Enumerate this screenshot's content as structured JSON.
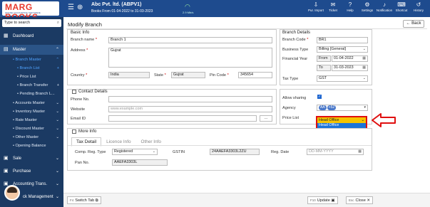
{
  "header": {
    "logo_text": "MARG BOOKS",
    "logo_tagline": "ONLINE ACCOUNTING SOFTWARE",
    "company": "Abc Pvt. ltd. (ABPV1)",
    "books_from": "Books From 01-04-2022 to 31-03-2023",
    "speed": "2.9 Mb/s",
    "tools": [
      {
        "label": "Pur. Import",
        "icon": "download-icon"
      },
      {
        "label": "Ticket",
        "icon": "ticket-icon"
      },
      {
        "label": "Help",
        "icon": "help-icon"
      },
      {
        "label": "Settings",
        "icon": "gear-icon"
      },
      {
        "label": "Notification",
        "icon": "bell-icon"
      },
      {
        "label": "Shortcut",
        "icon": "keyboard-icon"
      },
      {
        "label": "History",
        "icon": "history-icon"
      }
    ]
  },
  "sidebar": {
    "search_placeholder": "Type to search",
    "dashboard": "Dashboard",
    "master": "Master",
    "branch_master": "Branch Master",
    "branch_list": "Branch List",
    "price_list": "Price List",
    "branch_transfer": "Branch Transfer",
    "pending_branch": "Pending Branch L...",
    "accounts_master": "Accounts Master",
    "inventory_master": "Inventory Master",
    "rate_master": "Rate Master",
    "discount_master": "Discount Master",
    "other_master": "Other Master",
    "opening_balance": "Opening Balance",
    "sale": "Sale",
    "purchase": "Purchase",
    "accounting": "Accounting Trans.",
    "stock_management": "ck Management"
  },
  "page": {
    "title": "Modify Branch",
    "back_label": "Back"
  },
  "basic_info": {
    "section": "Basic Info",
    "branch_name_label": "Branch name",
    "branch_name": "Branch 1",
    "address_label": "Address",
    "address": "Gujrat",
    "country_label": "Country",
    "country": "India",
    "state_label": "State",
    "state": "Gujrat",
    "pin_label": "Pin Code",
    "pin": "345654"
  },
  "contact": {
    "section": "Contact Details",
    "phone_label": "Phone No.",
    "website_label": "Website",
    "website_placeholder": "www.example.com",
    "email_label": "Email ID",
    "email_btn": "..."
  },
  "branch_details": {
    "section": "Branch Details",
    "code_label": "Branch Code",
    "code": "BR1",
    "business_type_label": "Business Type",
    "business_type": "Billing [General]",
    "fy_label": "Financial Year",
    "from_label": "From",
    "from": "01-04-2022",
    "to_label": "To",
    "to": "31-03-2023",
    "tax_type_label": "Tax Type",
    "tax_type": "GST"
  },
  "sharing": {
    "allow_label": "Allow sharing",
    "agency_label": "Agency",
    "agency_tag": "AA",
    "agency_more": "+52",
    "price_list_label": "Price List",
    "price_list_selected": "Head Office",
    "price_list_option": "Head Office"
  },
  "more_info": {
    "section": "More Info",
    "tabs": [
      "Tax Detail",
      "Licence Info",
      "Other Info"
    ],
    "comp_reg_label": "Comp. Reg. Type",
    "comp_reg": "Registered",
    "gstin_label": "GSTIN",
    "gstin": "24AAEFA3303L2ZU",
    "reg_date_label": "Reg. Date",
    "reg_date_placeholder": "DD-MM-YYYY",
    "pan_label": "Pan No.",
    "pan": "AAEFA3303L"
  },
  "footer": {
    "switch_key": "F4",
    "switch_label": "Switch Tab",
    "update_key": "F10",
    "update_label": "Update",
    "close_key": "Esc",
    "close_label": "Close"
  }
}
